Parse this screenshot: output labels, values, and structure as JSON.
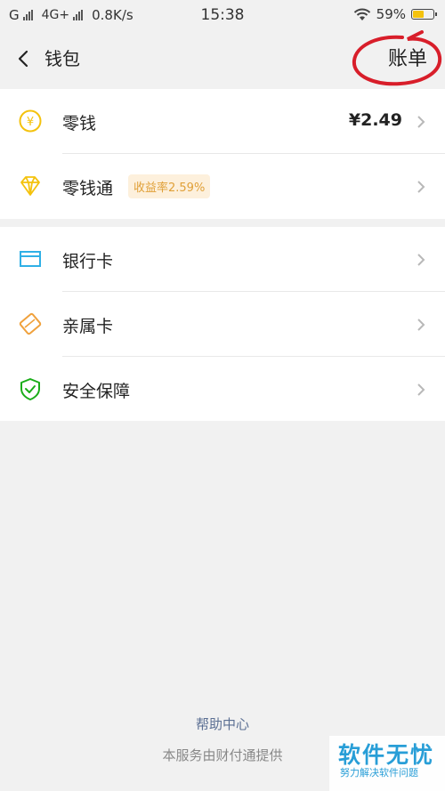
{
  "status_bar": {
    "carrier1": "G",
    "carrier2": "4G+",
    "speed": "0.8K/s",
    "time": "15:38",
    "battery": "59%",
    "battery_level": 0.59
  },
  "nav": {
    "title": "钱包",
    "bill_label": "账单"
  },
  "items_group1": [
    {
      "label": "零钱",
      "value": "¥2.49",
      "icon": "coin-icon"
    },
    {
      "label": "零钱通",
      "badge": "收益率2.59%",
      "icon": "diamond-icon"
    }
  ],
  "items_group2": [
    {
      "label": "银行卡",
      "icon": "card-icon"
    },
    {
      "label": "亲属卡",
      "icon": "family-card-icon"
    },
    {
      "label": "安全保障",
      "icon": "shield-icon"
    }
  ],
  "footer": {
    "help": "帮助中心",
    "provider": "本服务由财付通提供"
  },
  "watermark": {
    "title": "软件无忧",
    "subtitle": "努力解决软件问题"
  },
  "colors": {
    "accent_yellow": "#f4c20d",
    "card_blue": "#2fb0e6",
    "family_orange": "#f0a13c",
    "shield_green": "#1aad19",
    "annotation_red": "#d81e2a"
  }
}
